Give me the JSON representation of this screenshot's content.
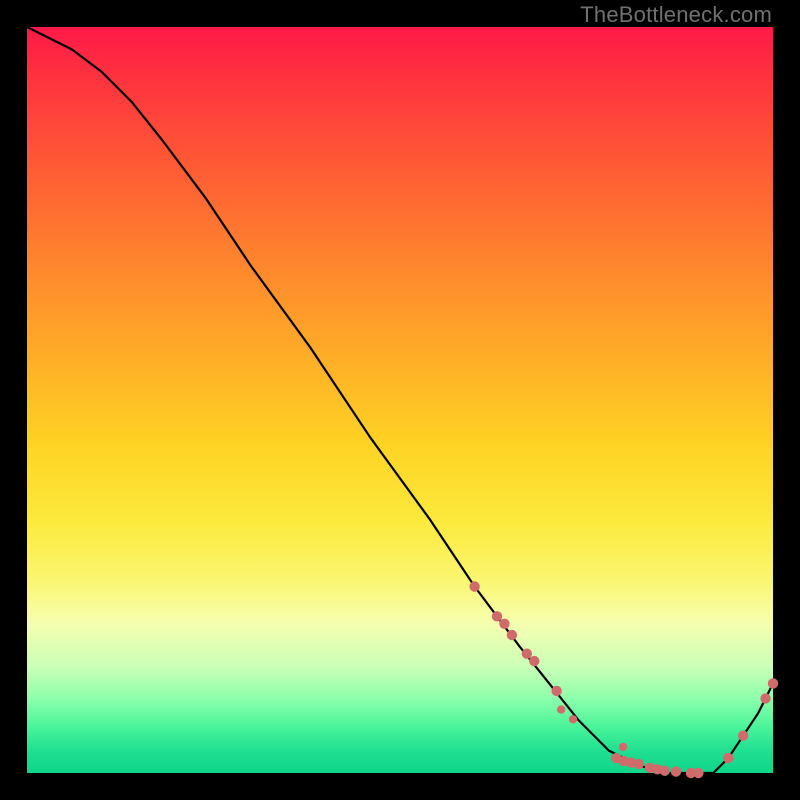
{
  "watermark": "TheBottleneck.com",
  "chart_data": {
    "type": "line",
    "title": "",
    "xlabel": "",
    "ylabel": "",
    "xlim": [
      0,
      100
    ],
    "ylim": [
      0,
      100
    ],
    "line": {
      "x": [
        0,
        6,
        10,
        14,
        18,
        24,
        30,
        38,
        46,
        54,
        60,
        66,
        70,
        74,
        78,
        82,
        86,
        88,
        92,
        94,
        96,
        98,
        100
      ],
      "y": [
        100,
        97,
        94,
        90,
        85,
        77,
        68,
        57,
        45,
        34,
        25,
        17,
        12,
        7,
        3,
        1,
        0,
        0,
        0,
        2,
        5,
        8,
        12
      ]
    },
    "markers_main": {
      "x": [
        60,
        63,
        64,
        65,
        67,
        68,
        71,
        79,
        80,
        81,
        82,
        83.5,
        84.5,
        85.5,
        87,
        89,
        90,
        94,
        96,
        99,
        100
      ],
      "y": [
        25,
        21,
        20,
        18.5,
        16,
        15,
        11,
        2,
        1.6,
        1.4,
        1.2,
        0.7,
        0.5,
        0.3,
        0.2,
        0,
        0,
        2,
        5,
        10,
        12
      ]
    },
    "markers_stray": {
      "x": [
        71.6,
        73.2,
        79.9
      ],
      "y": [
        8.5,
        7.2,
        3.5
      ]
    },
    "colors": {
      "line": "#000000",
      "marker": "#cf6b6b"
    }
  }
}
